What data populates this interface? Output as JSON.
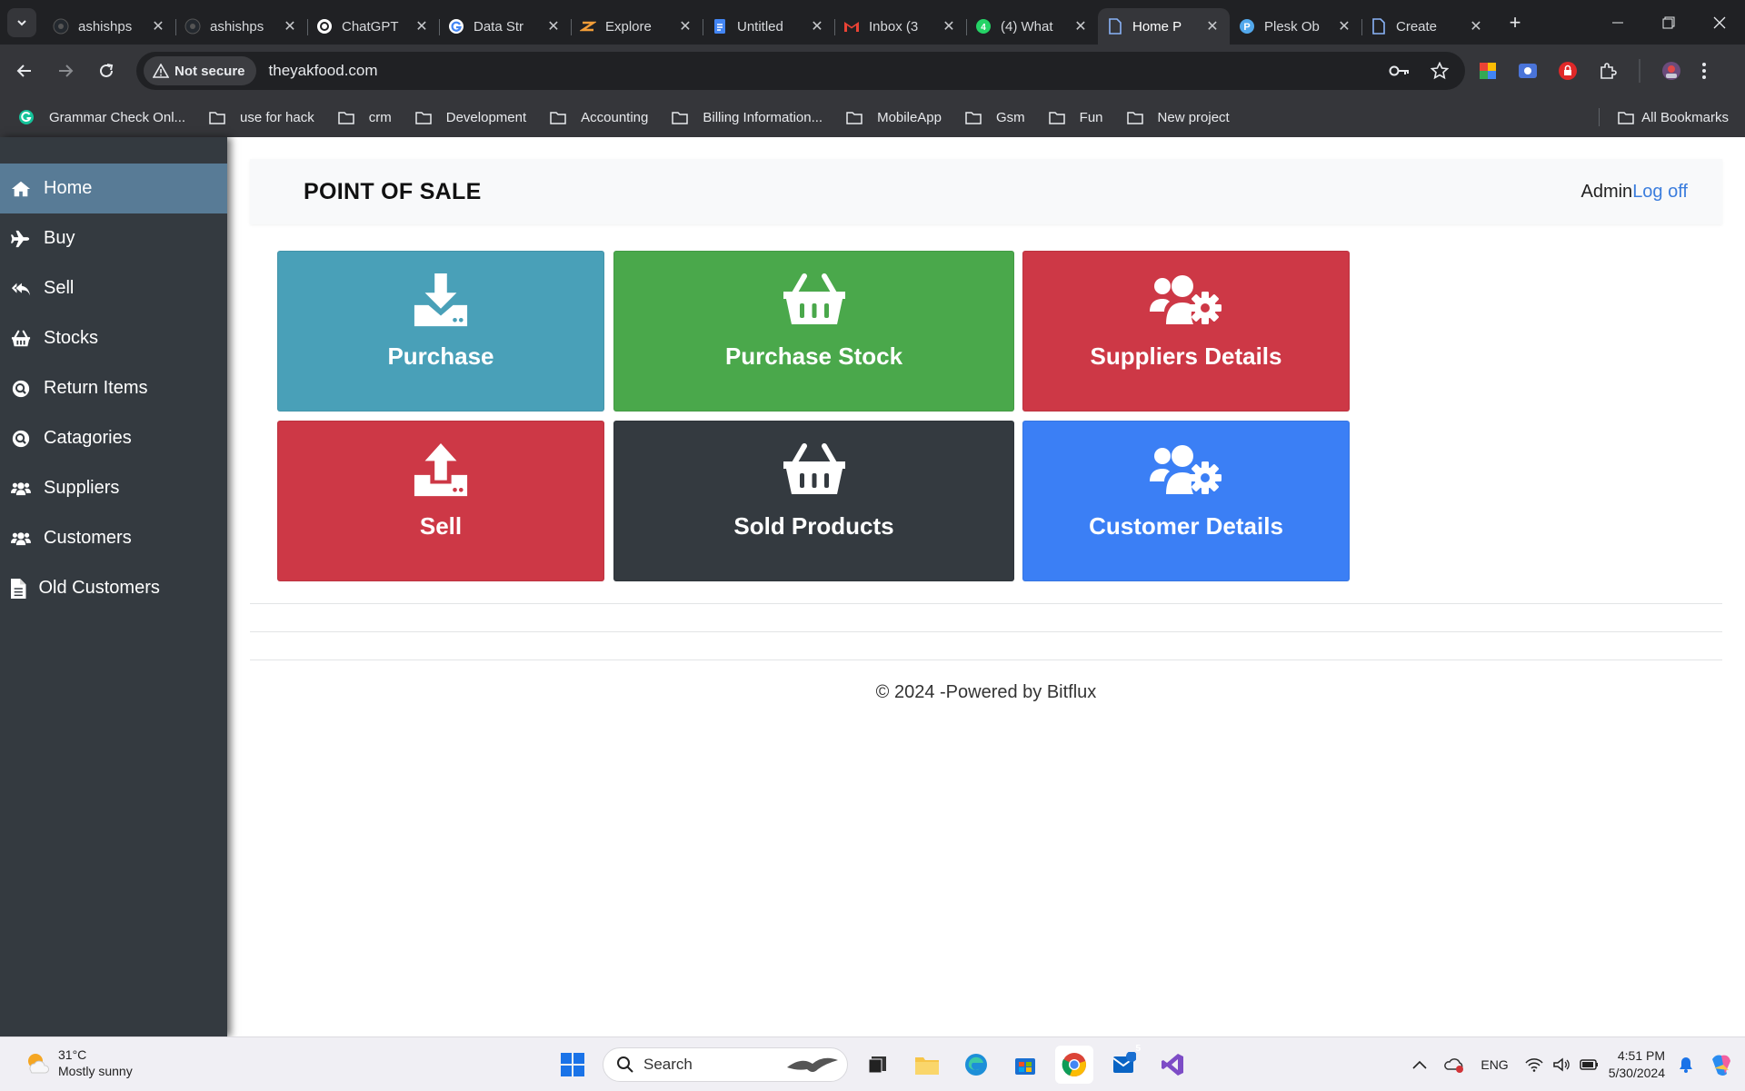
{
  "browser": {
    "tabs": [
      {
        "title": "ashishps",
        "icon": "github-icon",
        "color": "#24292f",
        "active": false
      },
      {
        "title": "ashishps",
        "icon": "github-icon",
        "color": "#24292f",
        "active": false
      },
      {
        "title": "ChatGPT",
        "icon": "chatgpt-icon",
        "color": "#ffffff",
        "active": false
      },
      {
        "title": "Data Str",
        "icon": "google-icon",
        "color": "#ffffff",
        "active": false
      },
      {
        "title": "Explore",
        "icon": "explore-icon",
        "color": "#f29d38",
        "active": false
      },
      {
        "title": "Untitled",
        "icon": "docs-icon",
        "color": "#4285f4",
        "active": false
      },
      {
        "title": "Inbox (3",
        "icon": "gmail-icon",
        "color": "#ea4335",
        "active": false
      },
      {
        "title": "(4) What",
        "icon": "whatsapp-icon",
        "color": "#25d366",
        "active": false
      },
      {
        "title": "Home P",
        "icon": "page-icon",
        "color": "#8ab4f8",
        "active": true
      },
      {
        "title": "Plesk Ob",
        "icon": "plesk-icon",
        "color": "#3b5998",
        "active": false
      },
      {
        "title": "Create",
        "icon": "page-icon",
        "color": "#8ab4f8",
        "active": false
      }
    ],
    "security_label": "Not secure",
    "url": "theyakfood.com",
    "bookmarks": [
      {
        "label": "Grammar Check Onl...",
        "icon": "grammar-icon"
      },
      {
        "label": "use for hack",
        "icon": "folder-icon"
      },
      {
        "label": "crm",
        "icon": "folder-icon"
      },
      {
        "label": "Development",
        "icon": "folder-icon"
      },
      {
        "label": "Accounting",
        "icon": "folder-icon"
      },
      {
        "label": "Billing Information...",
        "icon": "folder-icon"
      },
      {
        "label": "MobileApp",
        "icon": "folder-icon"
      },
      {
        "label": "Gsm",
        "icon": "folder-icon"
      },
      {
        "label": "Fun",
        "icon": "folder-icon"
      },
      {
        "label": "New project",
        "icon": "folder-icon"
      }
    ],
    "all_bookmarks_label": "All Bookmarks"
  },
  "sidebar": {
    "items": [
      {
        "label": "Home",
        "icon": "home-icon",
        "active": true
      },
      {
        "label": "Buy",
        "icon": "plane-icon",
        "active": false
      },
      {
        "label": "Sell",
        "icon": "reply-all-icon",
        "active": false
      },
      {
        "label": "Stocks",
        "icon": "basket-icon",
        "active": false
      },
      {
        "label": "Return Items",
        "icon": "search-circle-icon",
        "active": false
      },
      {
        "label": "Catagories",
        "icon": "search-circle-icon",
        "active": false
      },
      {
        "label": "Suppliers",
        "icon": "users-icon",
        "active": false
      },
      {
        "label": "Customers",
        "icon": "users-icon",
        "active": false
      },
      {
        "label": "Old Customers",
        "icon": "file-icon",
        "active": false
      }
    ]
  },
  "header": {
    "title": "POINT OF SALE",
    "user": "Admin",
    "logoff": "Log off"
  },
  "tiles": [
    {
      "label": "Purchase",
      "icon": "download-icon",
      "color": "#49a0b8"
    },
    {
      "label": "Purchase Stock",
      "icon": "basket-icon",
      "color": "#4aa84b"
    },
    {
      "label": "Suppliers Details",
      "icon": "users-cog-icon",
      "color": "#cd3846"
    },
    {
      "label": "Sell",
      "icon": "upload-icon",
      "color": "#cd3846"
    },
    {
      "label": "Sold Products",
      "icon": "basket-icon",
      "color": "#343a40"
    },
    {
      "label": "Customer Details",
      "icon": "users-cog-icon",
      "color": "#3b7ff5"
    }
  ],
  "footer": "© 2024 -Powered by Bitflux",
  "taskbar": {
    "weather_temp": "31°C",
    "weather_desc": "Mostly sunny",
    "search_placeholder": "Search",
    "language": "ENG",
    "time": "4:51 PM",
    "date": "5/30/2024",
    "mail_badge": "5"
  }
}
